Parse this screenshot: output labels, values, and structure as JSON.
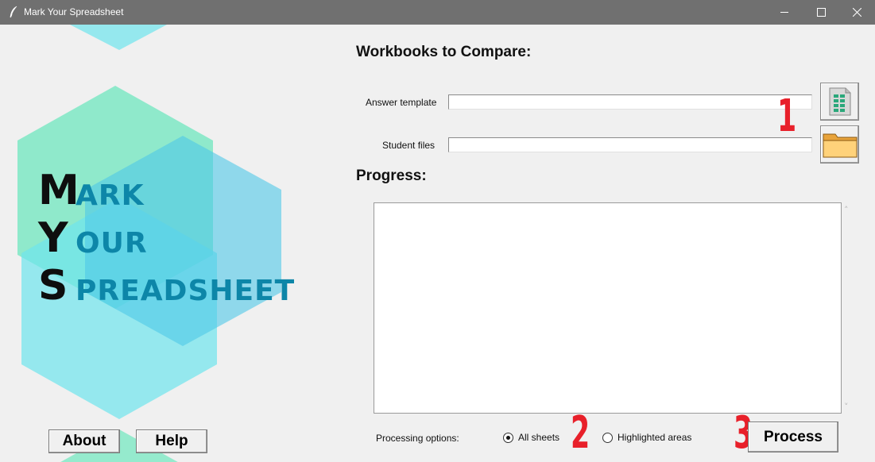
{
  "window": {
    "title": "Mark Your Spreadsheet",
    "icon": "feather-icon",
    "controls": [
      "minimize-icon",
      "maximize-icon",
      "close-icon"
    ]
  },
  "logo": {
    "lines": [
      {
        "initial": "M",
        "rest": "ARK"
      },
      {
        "initial": "Y",
        "rest": "OUR"
      },
      {
        "initial": "S",
        "rest": "PREADSHEET"
      }
    ],
    "colors": {
      "initial": "#0e0e0e",
      "rest": "#0d86a8",
      "hex_green": "#7ee8c4",
      "hex_cyan": "#6ee4ec",
      "hex_blue": "#4fc8e8"
    }
  },
  "buttons": {
    "about": "About",
    "help": "Help",
    "process": "Process"
  },
  "workbooks": {
    "heading": "Workbooks to Compare:",
    "answer_label": "Answer template",
    "answer_value": "",
    "student_label": "Student  files",
    "student_value": "",
    "answer_button_icon": "spreadsheet-icon",
    "student_button_icon": "folder-icon"
  },
  "progress": {
    "heading": "Progress:",
    "text": ""
  },
  "steps": {
    "one": "1",
    "two": "2",
    "three": "3",
    "color": "#e8202a"
  },
  "options": {
    "label": "Processing options:",
    "all_sheets": "All sheets",
    "highlighted": "Highlighted areas",
    "selected": "All sheets"
  }
}
